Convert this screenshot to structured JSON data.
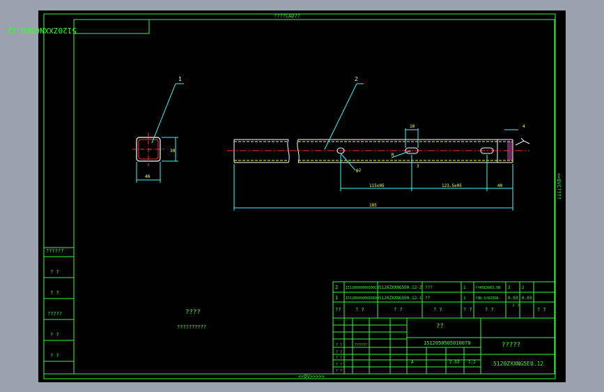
{
  "border": {
    "top_label": "????CAD??",
    "bottom_label": "<<OV>>>>>",
    "right_label": "<<QVC????"
  },
  "drawing_number_stamp": "5120ZXXNG5E0.12",
  "balloons": {
    "part1": "1",
    "part2": "2"
  },
  "dimensions": {
    "tube_height": "30",
    "tube_width": "40",
    "slot_top": "10",
    "radius_left": "φ2",
    "radius_mid": "R",
    "vert_small": "3",
    "top_right": "4",
    "seg1": "115±05",
    "seg2": "123.5±05",
    "seg3": "40",
    "total": "185"
  },
  "left_sidebar": {
    "cells": [
      "??????",
      "? ?",
      "? ?",
      "?????",
      "? ?",
      "? ?"
    ]
  },
  "notes": {
    "title": "????",
    "text": "??????????"
  },
  "bom": {
    "rows": [
      {
        "no": "2",
        "code": "1512050505010010",
        "drawing": "5120ZXXNG5E0.12-2",
        "name": "???",
        "qty": "1",
        "material": "??40X30X3.5B",
        "v1": "2",
        "v2": "2"
      },
      {
        "no": "1",
        "code": "1512050505010100",
        "drawing": "5120ZXXNG5E0.12-1",
        "name": "??",
        "qty": "1",
        "material": "?3B-3/Q235A",
        "v1": "0.03",
        "v2": "0.03"
      }
    ],
    "header": [
      "??",
      "? ?",
      "? ?",
      "? ?",
      "? ?",
      "? ?",
      "? ?",
      "? ?"
    ]
  },
  "title_block": {
    "title_cn": "??",
    "code": "1512050505010070",
    "company": "?????",
    "drawing_no": "5120ZXXNG5E0.12",
    "scale_flag": "A",
    "weight": "2.03",
    "scale": "1:2",
    "misc": [
      "??????",
      "? ?",
      "? ?",
      "? ?",
      "? ?",
      "? ?"
    ]
  }
}
